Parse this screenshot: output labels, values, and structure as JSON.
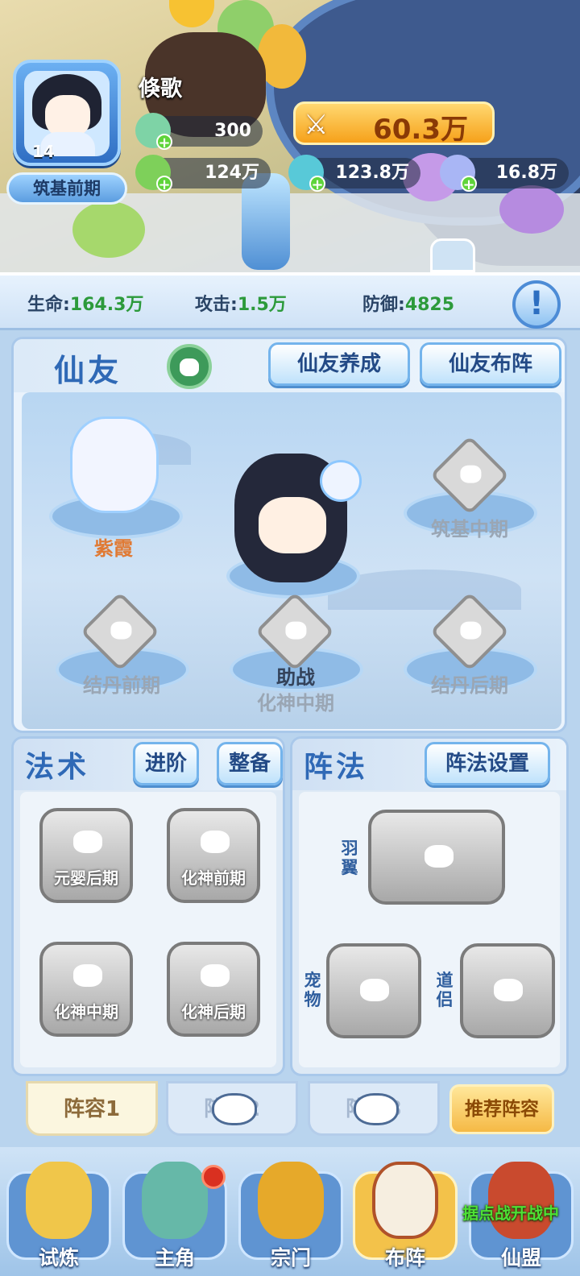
{
  "player": {
    "name": "倏歌",
    "level": "14",
    "realm": "筑基前期"
  },
  "resources": {
    "stamina": "300",
    "power": "60.3万",
    "jade": "124万",
    "crystal": "123.8万",
    "rainbow": "16.8万"
  },
  "stats": {
    "hp_label": "生命:",
    "hp_value": "164.3万",
    "atk_label": "攻击:",
    "atk_value": "1.5万",
    "def_label": "防御:",
    "def_value": "4825",
    "info_label": "!"
  },
  "companions": {
    "title": "仙友",
    "cultivate_button": "仙友养成",
    "formation_button": "仙友布阵",
    "companion_name": "紫霞",
    "slots": {
      "top_right": "筑基中期",
      "bottom_left": "结丹前期",
      "bottom_center_role": "助战",
      "bottom_center": "化神中期",
      "bottom_right": "结丹后期"
    }
  },
  "spells": {
    "title": "法术",
    "advance_button": "进阶",
    "equip_button": "整备",
    "slots": [
      "元婴后期",
      "化神前期",
      "化神中期",
      "化神后期"
    ]
  },
  "formation": {
    "title": "阵法",
    "settings_button": "阵法设置",
    "wings_label": "羽翼",
    "pet_label": "宠物",
    "partner_label": "道侣"
  },
  "lineups": {
    "tab1": "阵容1",
    "tab2": "阵容2",
    "tab3": "阵容3",
    "recommend_button": "推荐阵容"
  },
  "nav": {
    "items": [
      "试炼",
      "主角",
      "宗门",
      "布阵",
      "仙盟"
    ],
    "active": "布阵",
    "event_text": "据点战开战中"
  },
  "colors": {
    "stat_green": "#2c9a3b",
    "title_blue": "#2f69b6",
    "power_gold": "#f6a11a"
  }
}
